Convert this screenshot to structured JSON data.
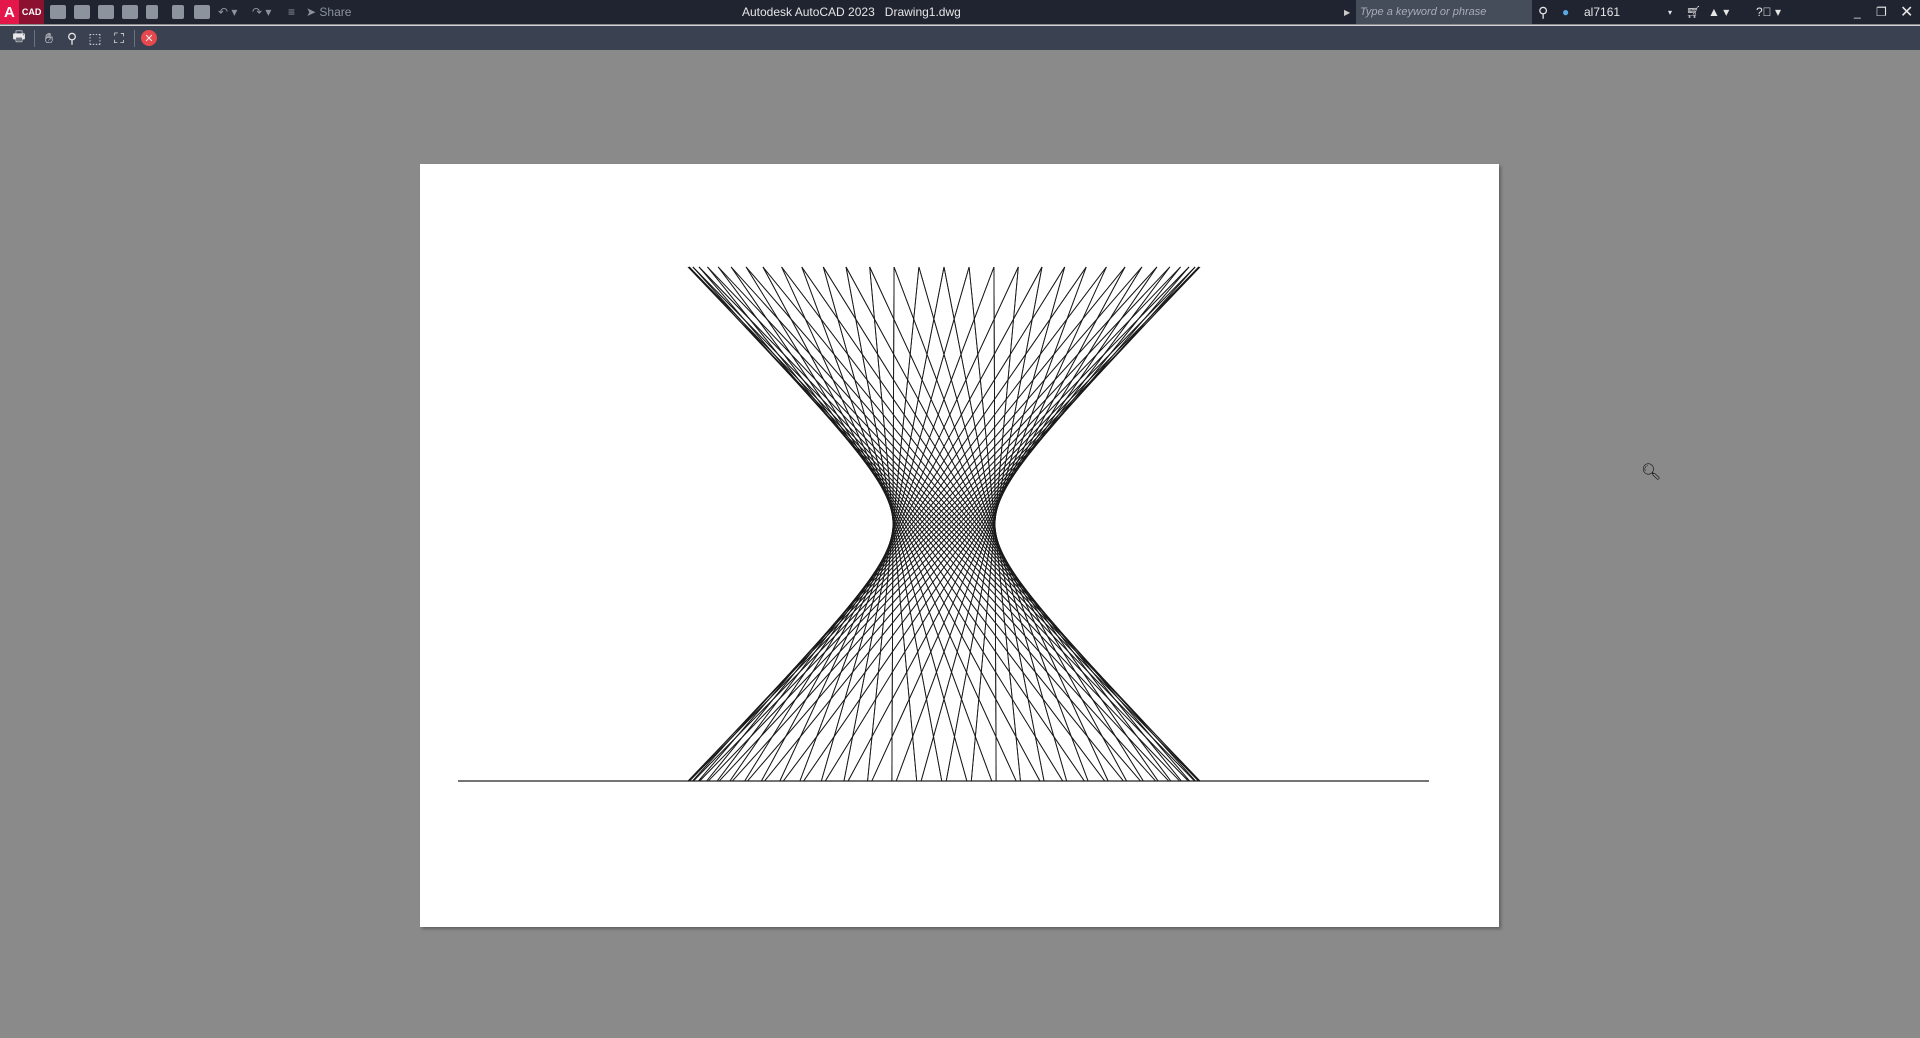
{
  "app": {
    "logo_main": "A",
    "logo_sub": "CAD",
    "title": "Autodesk AutoCAD 2023",
    "document": "Drawing1.dwg"
  },
  "quick_access": {
    "share_label": "Share"
  },
  "search": {
    "placeholder": "Type a keyword or phrase"
  },
  "user": {
    "name": "al7161"
  },
  "preview_toolbar": {
    "items": [
      "print",
      "pan",
      "zoom",
      "zoom-window",
      "zoom-original",
      "close-preview"
    ]
  },
  "drawing": {
    "line_count": 64,
    "twist_degrees": 157
  }
}
